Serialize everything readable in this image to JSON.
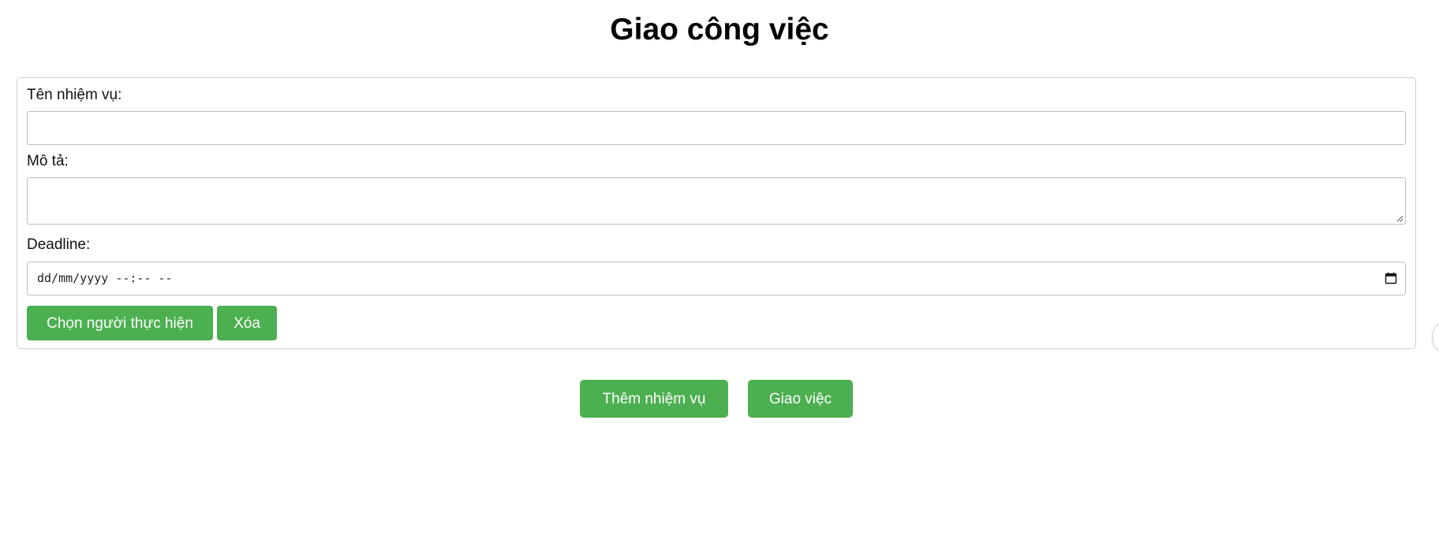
{
  "page": {
    "title": "Giao công việc"
  },
  "task_form": {
    "name_label": "Tên nhiệm vụ:",
    "name_value": "",
    "description_label": "Mô tả:",
    "description_value": "",
    "deadline_label": "Deadline:",
    "deadline_placeholder": "dd/mm/yyyy --:-- --",
    "choose_assignee_label": "Chọn người thực hiện",
    "delete_label": "Xóa"
  },
  "actions": {
    "add_task_label": "Thêm nhiệm vụ",
    "assign_label": "Giao việc"
  },
  "colors": {
    "button_green": "#4caf50",
    "border_gray": "#cccccc"
  },
  "icons": {
    "deadline_picker": "calendar-icon",
    "textarea_resize": "resize-grip-icon"
  }
}
